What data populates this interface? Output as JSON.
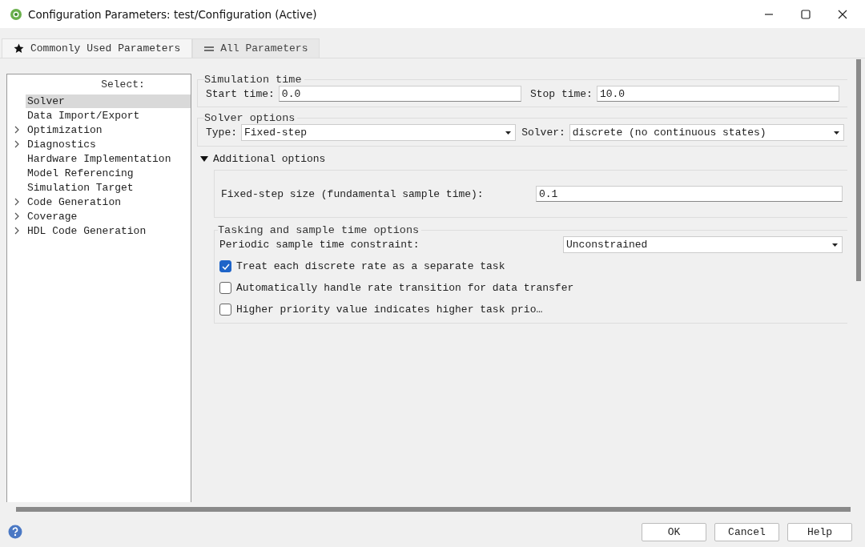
{
  "window": {
    "title": "Configuration Parameters: test/Configuration (Active)"
  },
  "tabs": [
    {
      "label": "Commonly Used Parameters",
      "selected": true
    },
    {
      "label": "All Parameters",
      "selected": false
    }
  ],
  "sidebar": {
    "heading": "Select:",
    "items": [
      {
        "label": "Solver",
        "expandable": false,
        "selected": true
      },
      {
        "label": "Data Import/Export",
        "expandable": false,
        "selected": false
      },
      {
        "label": "Optimization",
        "expandable": true,
        "selected": false
      },
      {
        "label": "Diagnostics",
        "expandable": true,
        "selected": false
      },
      {
        "label": "Hardware Implementation",
        "expandable": false,
        "selected": false
      },
      {
        "label": "Model Referencing",
        "expandable": false,
        "selected": false
      },
      {
        "label": "Simulation Target",
        "expandable": false,
        "selected": false
      },
      {
        "label": "Code Generation",
        "expandable": true,
        "selected": false
      },
      {
        "label": "Coverage",
        "expandable": true,
        "selected": false
      },
      {
        "label": "HDL Code Generation",
        "expandable": true,
        "selected": false
      }
    ]
  },
  "simulation_time": {
    "title": "Simulation time",
    "fields": [
      {
        "label": "Start time:",
        "value": "0.0"
      },
      {
        "label": "Stop time:",
        "value": "10.0"
      }
    ]
  },
  "solver_options": {
    "title": "Solver options",
    "dropdowns": [
      {
        "label": "Type:",
        "value": "Fixed-step"
      },
      {
        "label": "Solver:",
        "value": "discrete (no continuous states)"
      }
    ]
  },
  "additional_options": {
    "label": "Additional options",
    "expanded": true,
    "step_size": {
      "label": "Fixed-step size (fundamental sample time):",
      "value": "0.1"
    },
    "tasking": {
      "title": "Tasking and sample time options",
      "constraint": {
        "label": "Periodic sample time constraint:",
        "value": "Unconstrained"
      },
      "checkboxes": [
        {
          "label": "Treat each discrete rate as a separate task",
          "checked": true
        },
        {
          "label": "Automatically handle rate transition for data transfer",
          "checked": false
        },
        {
          "label": "Higher priority value indicates higher task prio…",
          "checked": false
        }
      ]
    }
  },
  "buttons": [
    "OK",
    "Cancel",
    "Help"
  ]
}
